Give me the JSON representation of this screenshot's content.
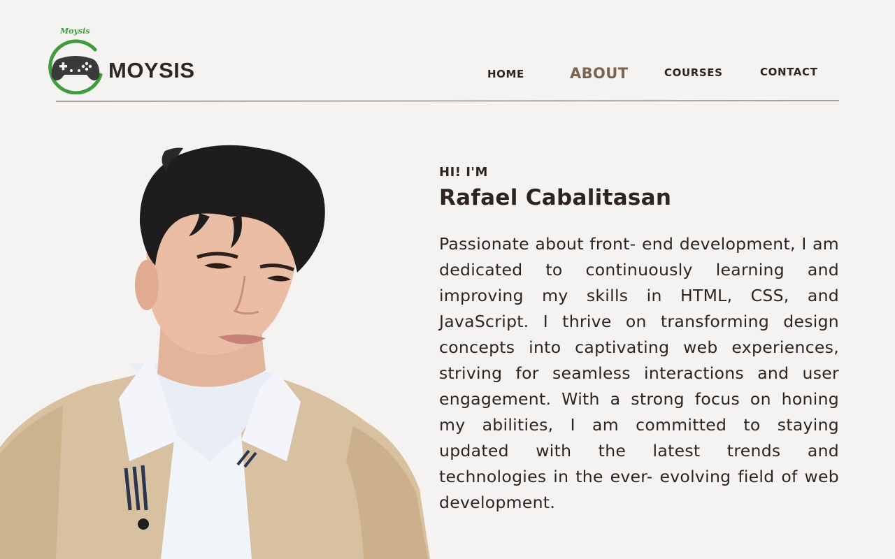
{
  "brand": {
    "script_text": "Moysis",
    "wordmark": "MOYSIS",
    "emblem_icon": "gamepad-icon",
    "colors": {
      "ring": "#3f9b3c",
      "controller": "#3a3a3a"
    }
  },
  "nav": {
    "items": [
      {
        "label": "HOME",
        "active": false
      },
      {
        "label": "ABOUT",
        "active": true
      },
      {
        "label": "COURSES",
        "active": false
      },
      {
        "label": "CONTACT",
        "active": false
      }
    ],
    "active_color": "#7b6350"
  },
  "intro": {
    "greeting": "HI! I'M",
    "name": "Rafael Cabalitasan",
    "bio": "Passionate about front- end development, I am dedicated to continuously learning and improving my skills in HTML, CSS, and JavaScript. I thrive on transforming design concepts into captivating web experiences, striving for seamless interactions and user engagement. With a strong focus on honing my abilities, I am committed to staying updated with the latest trends and technologies in the ever- evolving field of web development."
  },
  "colors": {
    "background": "#f5f3f2",
    "text": "#2b2522",
    "divider": "#5a4d45"
  }
}
